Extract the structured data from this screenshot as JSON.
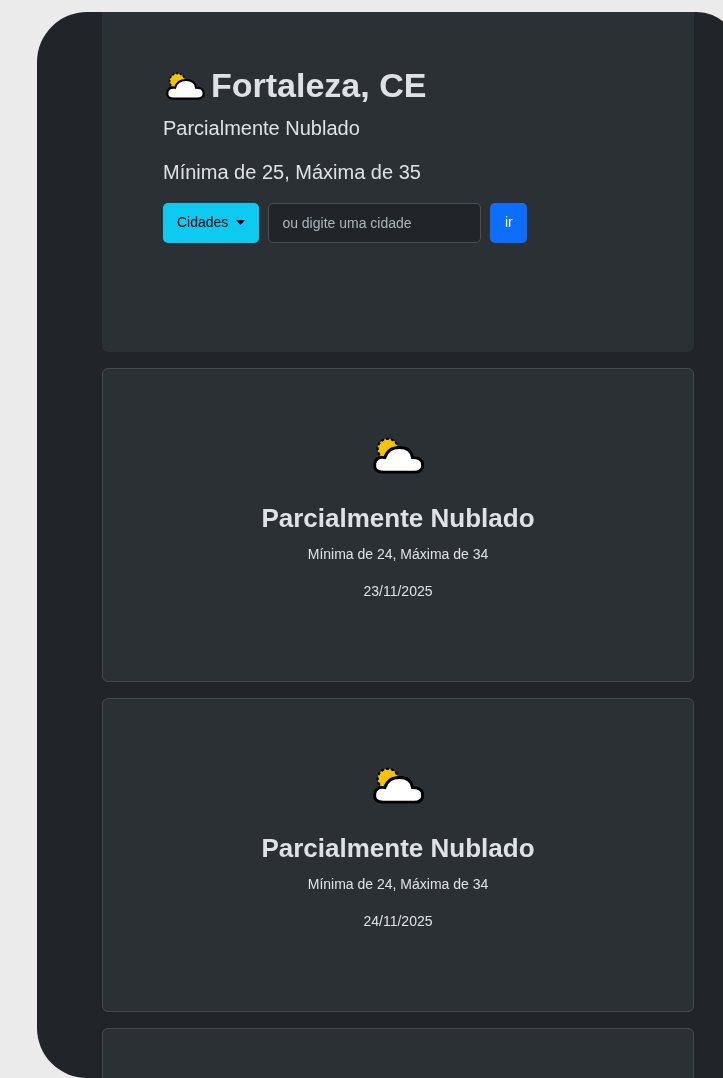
{
  "header": {
    "city": "Fortaleza, CE",
    "condition": "Parcialmente Nublado",
    "range": "Mínima de 25, Máxima de 35",
    "dropdown": "Cidades",
    "search": {
      "placeholder": "ou digite uma cidade"
    },
    "go_button": "ir"
  },
  "forecast": [
    {
      "condition": "Parcialmente Nublado",
      "range": "Mínima de 24, Máxima de 34",
      "date": "23/11/2025"
    },
    {
      "condition": "Parcialmente Nublado",
      "range": "Mínima de 24, Máxima de 34",
      "date": "24/11/2025"
    }
  ]
}
